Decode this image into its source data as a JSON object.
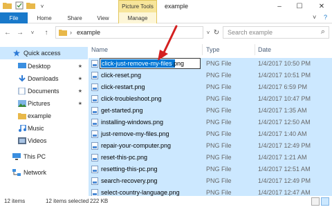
{
  "window": {
    "title": "example",
    "picture_tools_label": "Picture Tools"
  },
  "ribbon": {
    "tabs": [
      "File",
      "Home",
      "Share",
      "View",
      "Manage"
    ],
    "minimize_label": "–",
    "maximize_label": "☐",
    "close_label": "✕",
    "expand_label": "˅",
    "help_label": "?"
  },
  "address": {
    "back": "←",
    "forward": "→",
    "dropdown": "˅",
    "up": "↑",
    "path_separator": "›",
    "path": "example",
    "dropdown2": "˅",
    "refresh": "↻",
    "search_placeholder": "Search example",
    "search_icon": "⌕"
  },
  "nav": {
    "items": [
      {
        "label": "Quick access",
        "icon": "star-icon",
        "pinned": false,
        "selected": true
      },
      {
        "label": "Desktop",
        "icon": "desktop-icon",
        "pinned": true
      },
      {
        "label": "Downloads",
        "icon": "download-icon",
        "pinned": true
      },
      {
        "label": "Documents",
        "icon": "documents-icon",
        "pinned": true
      },
      {
        "label": "Pictures",
        "icon": "pictures-icon",
        "pinned": true
      },
      {
        "label": "example",
        "icon": "folder-icon",
        "pinned": false
      },
      {
        "label": "Music",
        "icon": "music-icon",
        "pinned": false
      },
      {
        "label": "Videos",
        "icon": "videos-icon",
        "pinned": false
      },
      {
        "label": "This PC",
        "icon": "pc-icon",
        "pinned": false
      },
      {
        "label": "Network",
        "icon": "network-icon",
        "pinned": false
      }
    ],
    "pin_glyph": "★"
  },
  "columns": {
    "name": "Name",
    "type": "Type",
    "date": "Date"
  },
  "rename": {
    "selected_part": "click-just-remove-my-files",
    "extension": ".png"
  },
  "files": [
    {
      "name": "click-just-remove-my-files.png",
      "type": "PNG File",
      "date": "1/4/2017 10:50 PM"
    },
    {
      "name": "click-reset.png",
      "type": "PNG File",
      "date": "1/4/2017 10:51 PM"
    },
    {
      "name": "click-restart.png",
      "type": "PNG File",
      "date": "1/4/2017 6:59 PM"
    },
    {
      "name": "click-troubleshoot.png",
      "type": "PNG File",
      "date": "1/4/2017 10:47 PM"
    },
    {
      "name": "get-started.png",
      "type": "PNG File",
      "date": "1/4/2017 1:35 AM"
    },
    {
      "name": "installing-windows.png",
      "type": "PNG File",
      "date": "1/4/2017 12:50 AM"
    },
    {
      "name": "just-remove-my-files.png",
      "type": "PNG File",
      "date": "1/4/2017 1:40 AM"
    },
    {
      "name": "repair-your-computer.png",
      "type": "PNG File",
      "date": "1/4/2017 12:49 PM"
    },
    {
      "name": "reset-this-pc.png",
      "type": "PNG File",
      "date": "1/4/2017 1:21 AM"
    },
    {
      "name": "resetting-this-pc.png",
      "type": "PNG File",
      "date": "1/4/2017 12:51 AM"
    },
    {
      "name": "search-recovery.png",
      "type": "PNG File",
      "date": "1/4/2017 12:49 PM"
    },
    {
      "name": "select-country-language.png",
      "type": "PNG File",
      "date": "1/4/2017 12:47 AM"
    }
  ],
  "status": {
    "items": "12 items",
    "selected": "12 items selected",
    "size": "222 KB"
  },
  "colors": {
    "accent": "#1979ca",
    "selection": "#cce8ff",
    "picture_tools": "#f7e59a",
    "annotation_arrow": "#d42020"
  }
}
